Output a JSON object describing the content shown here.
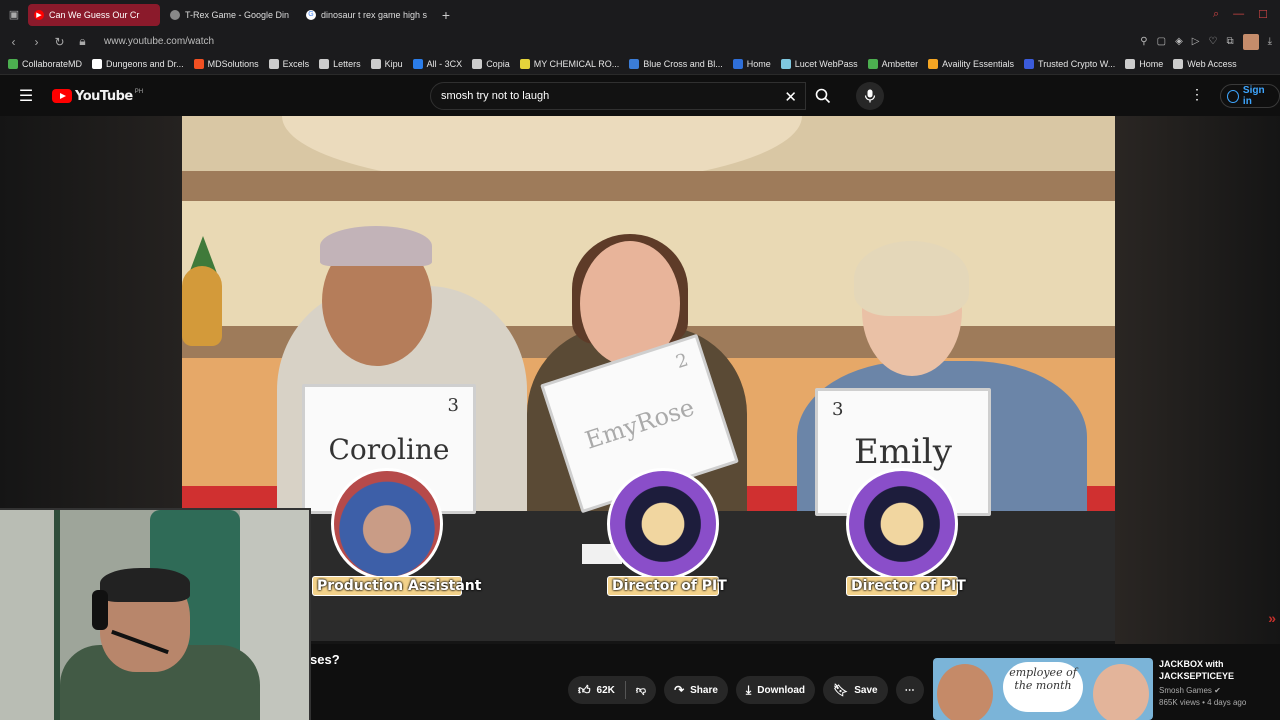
{
  "browser": {
    "tabs": [
      {
        "label": "Can We Guess Our Cr",
        "active": true,
        "icon": "youtube-icon"
      },
      {
        "label": "T-Rex Game - Google Din",
        "active": false,
        "icon": "dino-icon"
      },
      {
        "label": "dinosaur t rex game high s",
        "active": false,
        "icon": "google-icon"
      }
    ],
    "new_tab": "+",
    "url": "www.youtube.com/watch",
    "bookmarks": [
      {
        "label": "CollaborateMD",
        "icon": "leaf-icon",
        "color": "#4caf50"
      },
      {
        "label": "Dungeons and Dr...",
        "icon": "dnd-icon",
        "color": "#ffffff"
      },
      {
        "label": "MDSolutions",
        "icon": "windows-icon",
        "color": "#f25022"
      },
      {
        "label": "Excels",
        "icon": "folder-icon",
        "color": "#cccccc"
      },
      {
        "label": "Letters",
        "icon": "folder-icon",
        "color": "#cccccc"
      },
      {
        "label": "Kipu",
        "icon": "folder-icon",
        "color": "#cccccc"
      },
      {
        "label": "All - 3CX",
        "icon": "3cx-icon",
        "color": "#2b7de9"
      },
      {
        "label": "Copia",
        "icon": "page-icon",
        "color": "#cccccc"
      },
      {
        "label": "MY CHEMICAL RO...",
        "icon": "mcr-icon",
        "color": "#e5d43b"
      },
      {
        "label": "Blue Cross and Bl...",
        "icon": "bluecross-icon",
        "color": "#3b7dd8"
      },
      {
        "label": "Home",
        "icon": "globe-icon",
        "color": "#2f6fd8"
      },
      {
        "label": "Lucet WebPass",
        "icon": "lucet-icon",
        "color": "#7fc8e0"
      },
      {
        "label": "Ambetter",
        "icon": "ambetter-icon",
        "color": "#4caf50"
      },
      {
        "label": "Availity Essentials",
        "icon": "availity-icon",
        "color": "#f5a623"
      },
      {
        "label": "Trusted Crypto W...",
        "icon": "crypto-icon",
        "color": "#3b5bdb"
      },
      {
        "label": "Home",
        "icon": "page-icon",
        "color": "#cccccc"
      },
      {
        "label": "Web Access",
        "icon": "page-icon",
        "color": "#cccccc"
      }
    ]
  },
  "youtube": {
    "logo_text": "YouTube",
    "region": "PH",
    "search_value": "smosh try not to laugh",
    "sign_in": "Sign in"
  },
  "video": {
    "boards": [
      {
        "name": "Coroline",
        "number": "3"
      },
      {
        "name": "EmyRose",
        "number": "2"
      },
      {
        "name": "Emily",
        "number": "3"
      }
    ],
    "badges": [
      "Production Assistant",
      "Director of PIT",
      "Director of PIT"
    ],
    "next_icon": "»"
  },
  "below": {
    "title_fragment": "ses?",
    "likes": "62K",
    "share": "Share",
    "download": "Download",
    "save": "Save"
  },
  "recommendation": {
    "thumb_text": "employee of the month",
    "title": "JACKBOX with JACKSEPTICEYE",
    "channel": "Smosh Games",
    "stats": "865K views • 4 days ago"
  }
}
